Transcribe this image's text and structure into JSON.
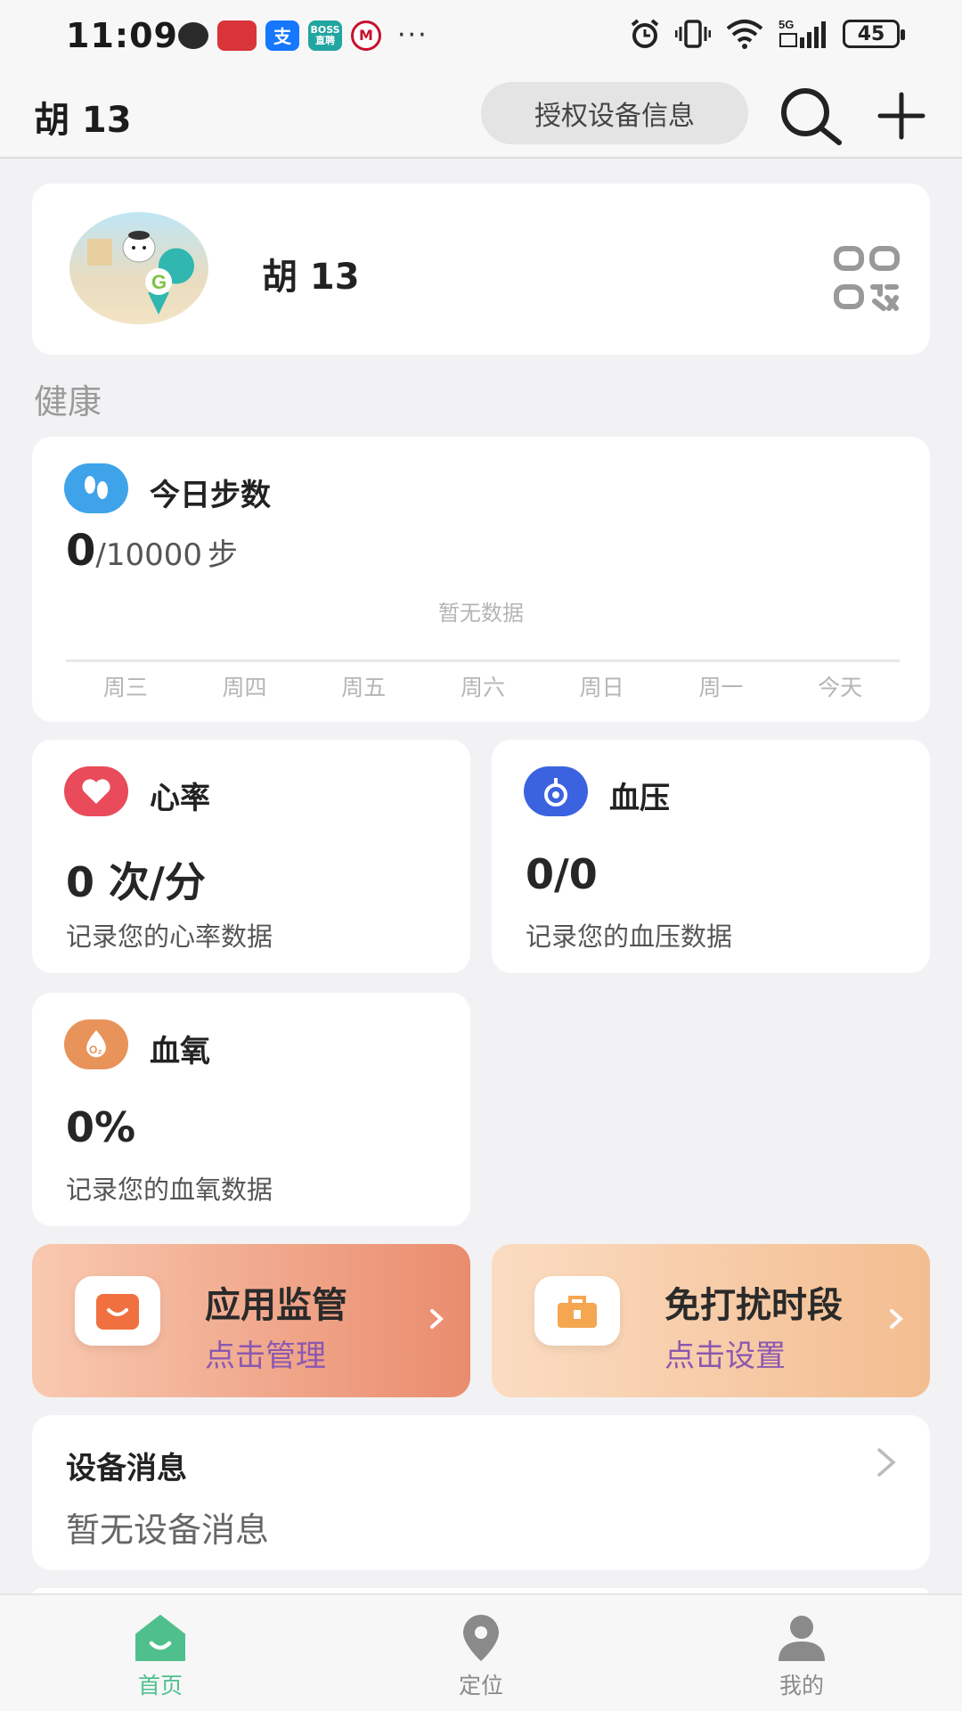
{
  "status_bar": {
    "time": "11:09",
    "battery": "45",
    "network": "5G"
  },
  "header": {
    "title": "胡 13",
    "auth_button": "授权设备信息",
    "icons": [
      "search-icon",
      "add-icon"
    ]
  },
  "profile": {
    "name": "胡 13",
    "qr_icon": "qr-code-icon"
  },
  "health_section": {
    "title": "健康"
  },
  "steps": {
    "label": "今日步数",
    "value": "0",
    "target": "/10000",
    "unit": "步",
    "no_data": "暂无数据",
    "days": [
      "周三",
      "周四",
      "周五",
      "周六",
      "周日",
      "周一",
      "今天"
    ]
  },
  "heart_rate": {
    "label": "心率",
    "value": "0 次/分",
    "description": "记录您的心率数据",
    "color": "#e94b5a"
  },
  "blood_pressure": {
    "label": "血压",
    "value": "0/0",
    "description": "记录您的血压数据",
    "color": "#3b63e0"
  },
  "blood_oxygen": {
    "label": "血氧",
    "value": "0%",
    "description": "记录您的血氧数据",
    "color": "#e8935a"
  },
  "app_monitor": {
    "title": "应用监管",
    "subtitle": "点击管理"
  },
  "dnd": {
    "title": "免打扰时段",
    "subtitle": "点击设置"
  },
  "device_messages": {
    "title": "设备消息",
    "empty": "暂无设备消息"
  },
  "bottom_nav": {
    "home": "首页",
    "location": "定位",
    "mine": "我的",
    "active_color": "#4fc08d"
  }
}
